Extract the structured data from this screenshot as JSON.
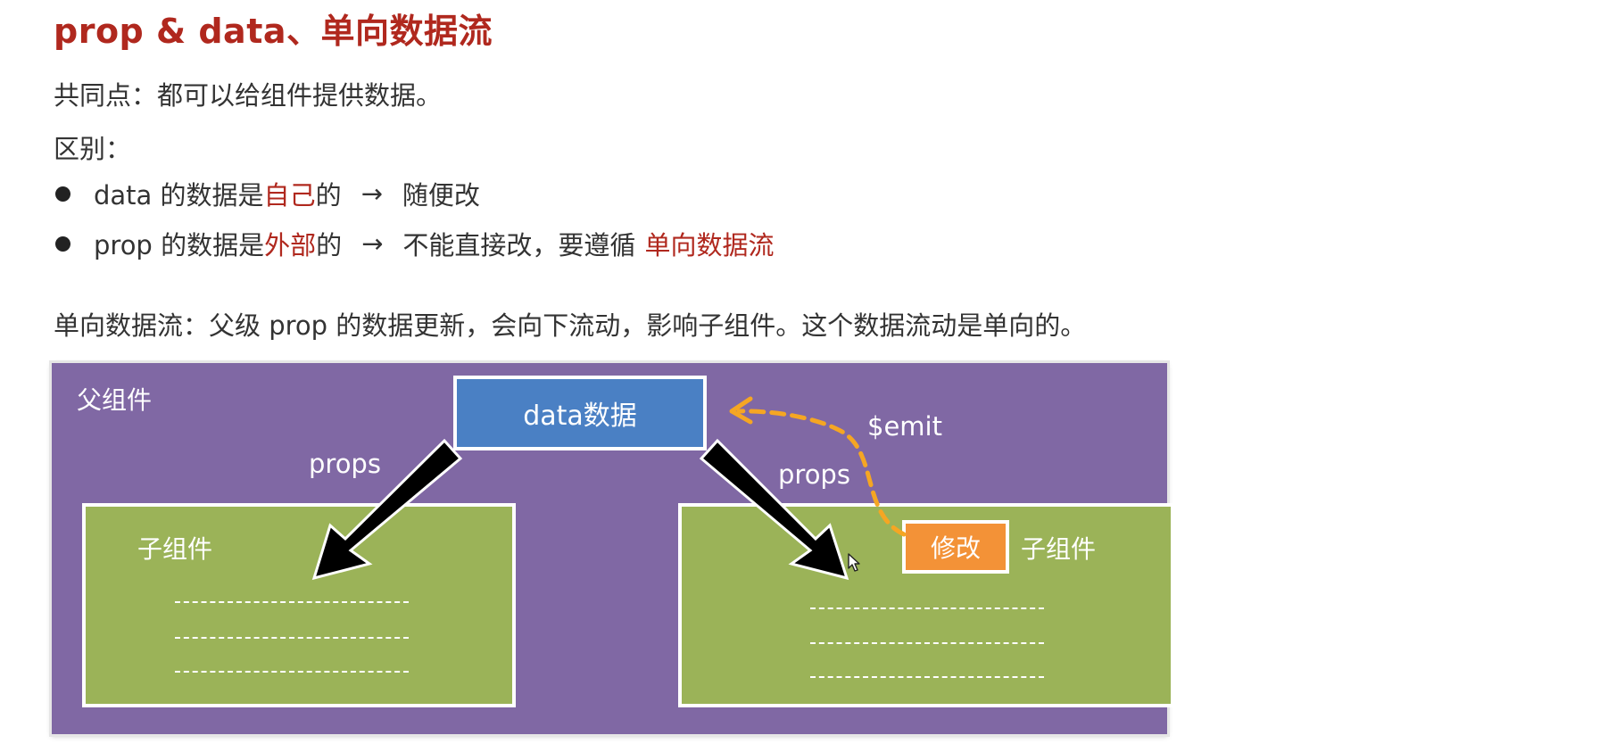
{
  "header": {
    "title": "prop & data、单向数据流"
  },
  "content": {
    "common_point": "共同点：都可以给组件提供数据。",
    "difference_label": "区别：",
    "bullets": [
      {
        "prefix": "data 的数据是",
        "highlight": "自己",
        "suffix": "的",
        "arrow": "→",
        "result": "随便改",
        "result_highlight": ""
      },
      {
        "prefix": "prop 的数据是",
        "highlight": "外部",
        "suffix": "的",
        "arrow": "→",
        "result": "不能直接改，要遵循",
        "result_highlight": "单向数据流"
      }
    ],
    "one_way_flow": "单向数据流：父级 prop 的数据更新，会向下流动，影响子组件。这个数据流动是单向的。"
  },
  "diagram": {
    "parent_label": "父组件",
    "data_box_label": "data数据",
    "left_props_label": "props",
    "right_props_label": "props",
    "emit_label": "$emit",
    "left_child_label": "子组件",
    "right_child_label": "子组件",
    "modify_button_label": "修改",
    "colors": {
      "parent_bg": "#8068a4",
      "data_box": "#4a80c4",
      "child_bg": "#9bb358",
      "modify_button": "#f39237",
      "emit_arrow": "#f5a623",
      "title_red": "#b0281e"
    },
    "icons": [
      "arrow-down-left-icon",
      "arrow-down-right-icon",
      "emit-curved-arrow-icon",
      "mouse-cursor-icon"
    ]
  }
}
